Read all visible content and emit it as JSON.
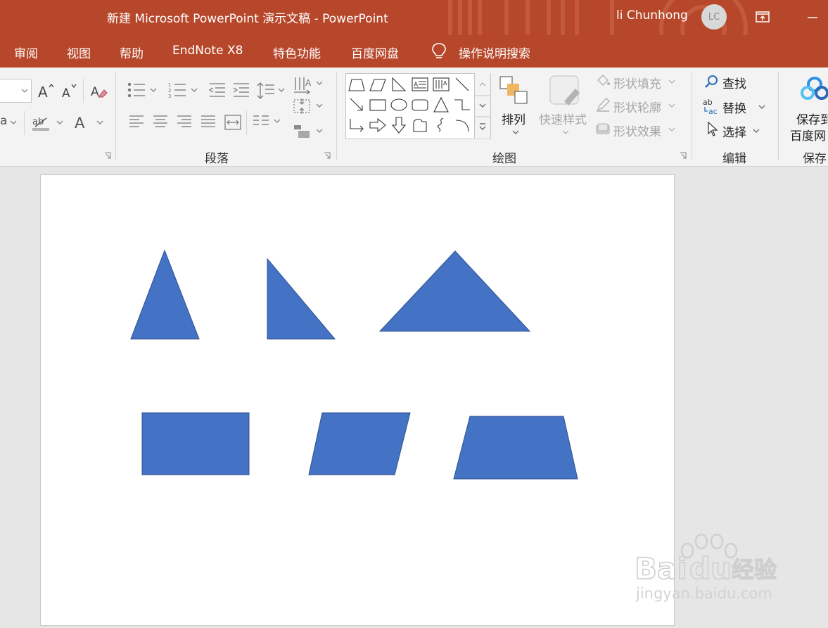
{
  "titlebar": {
    "doc_title": "新建 Microsoft PowerPoint 演示文稿  -  PowerPoint",
    "user_name": "li Chunhong",
    "avatar_initials": "LC",
    "bg_color": "#b7472a"
  },
  "menu": {
    "items": [
      "审阅",
      "视图",
      "帮助",
      "EndNote X8",
      "特色功能",
      "百度网盘"
    ],
    "search_label": "操作说明搜索"
  },
  "ribbon": {
    "font": {
      "case_label": "a"
    },
    "groups": {
      "paragraph": "段落",
      "drawing": "绘图",
      "editing": "编辑",
      "save": "保存"
    },
    "drawing": {
      "arrange": "排列",
      "quick_styles": "快速样式",
      "shape_fill": "形状填充",
      "shape_outline": "形状轮廓",
      "shape_effects": "形状效果"
    },
    "editing": {
      "find": "查找",
      "replace": "替换",
      "select": "选择"
    },
    "save": {
      "line1": "保存到",
      "line2": "百度网"
    }
  },
  "slide": {
    "shape_color": "#4472c4",
    "shapes": [
      "isosceles-triangle",
      "right-triangle",
      "wide-triangle",
      "rectangle",
      "parallelogram",
      "trapezoid"
    ]
  },
  "watermark": {
    "brand": "Bai",
    "brand2": "du",
    "cn": "经验",
    "url": "jingyan.baidu.com"
  }
}
